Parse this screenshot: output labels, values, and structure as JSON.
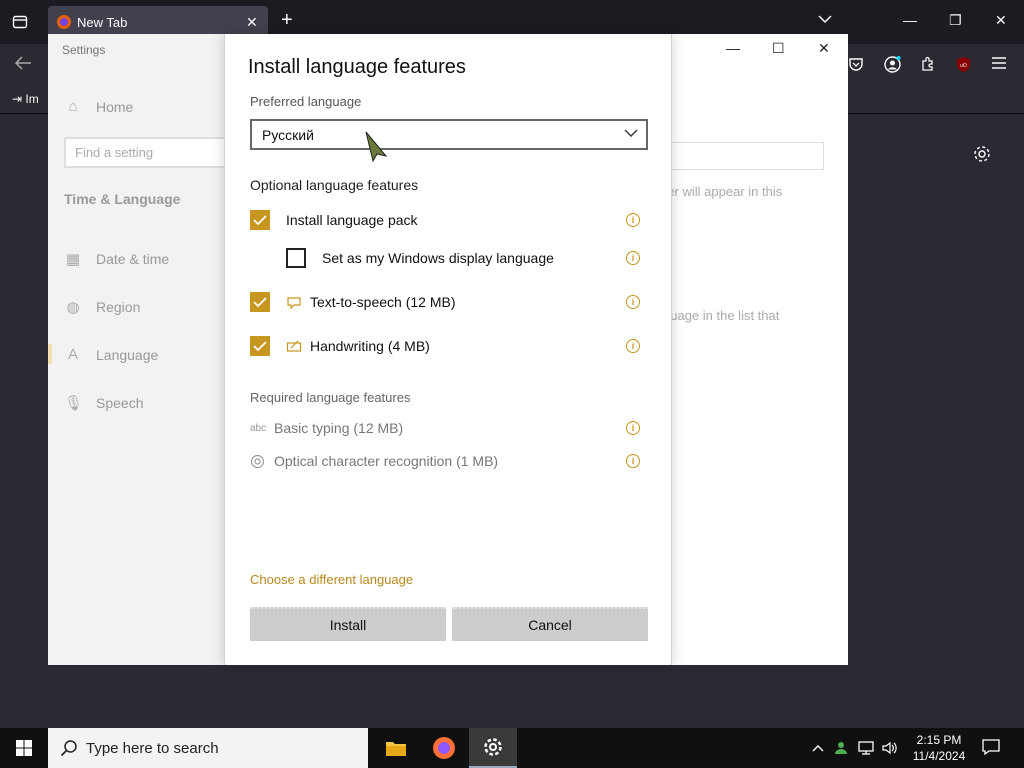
{
  "browser": {
    "tab_title": "New Tab",
    "bookmark_import_label": "Im"
  },
  "settings": {
    "window_title": "Settings",
    "home_label": "Home",
    "find_placeholder": "Find a setting",
    "section_heading": "Time & Language",
    "nav_items": [
      {
        "label": "Date & time",
        "icon": "calendar-clock-icon"
      },
      {
        "label": "Region",
        "icon": "globe-icon"
      },
      {
        "label": "Language",
        "icon": "language-icon"
      },
      {
        "label": "Speech",
        "icon": "microphone-icon"
      }
    ],
    "background_text_1": "rer will appear in this",
    "background_text_2": "guage in the list that"
  },
  "dialog": {
    "title": "Install language features",
    "preferred_label": "Preferred language",
    "selected_language": "Русский",
    "optional_heading": "Optional language features",
    "optional_features": [
      {
        "label": "Install language pack",
        "checked": true
      },
      {
        "label": "Set as my Windows display language",
        "checked": false
      },
      {
        "label": "Text-to-speech (12 MB)",
        "checked": true
      },
      {
        "label": "Handwriting (4 MB)",
        "checked": true
      }
    ],
    "required_heading": "Required language features",
    "required_features": [
      {
        "label": "Basic typing (12 MB)",
        "icon": "abc-icon"
      },
      {
        "label": "Optical character recognition (1 MB)",
        "icon": "ocr-icon"
      }
    ],
    "choose_link": "Choose a different language",
    "install_label": "Install",
    "cancel_label": "Cancel",
    "accent_color": "#c7961e"
  },
  "taskbar": {
    "search_placeholder": "Type here to search",
    "time": "2:15 PM",
    "date": "11/4/2024"
  }
}
